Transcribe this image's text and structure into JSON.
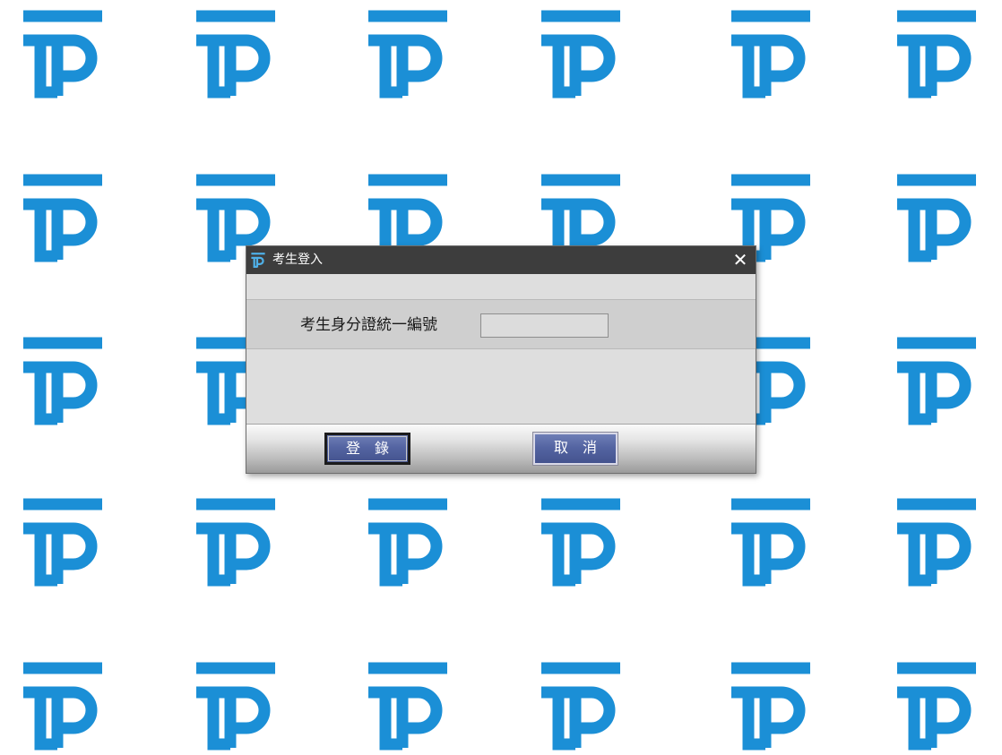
{
  "background": {
    "brand_color": "#1b8fd6",
    "icon": "tp-logo-icon"
  },
  "dialog": {
    "title": "考生登入",
    "title_icon": "tp-logo-icon",
    "close_label": "✕",
    "field_label": "考生身分證統一編號",
    "field_value": "",
    "login_label": "登　錄",
    "cancel_label": "取　消",
    "colors": {
      "titlebar": "#3d3d3d",
      "button": "#5464a2"
    }
  }
}
